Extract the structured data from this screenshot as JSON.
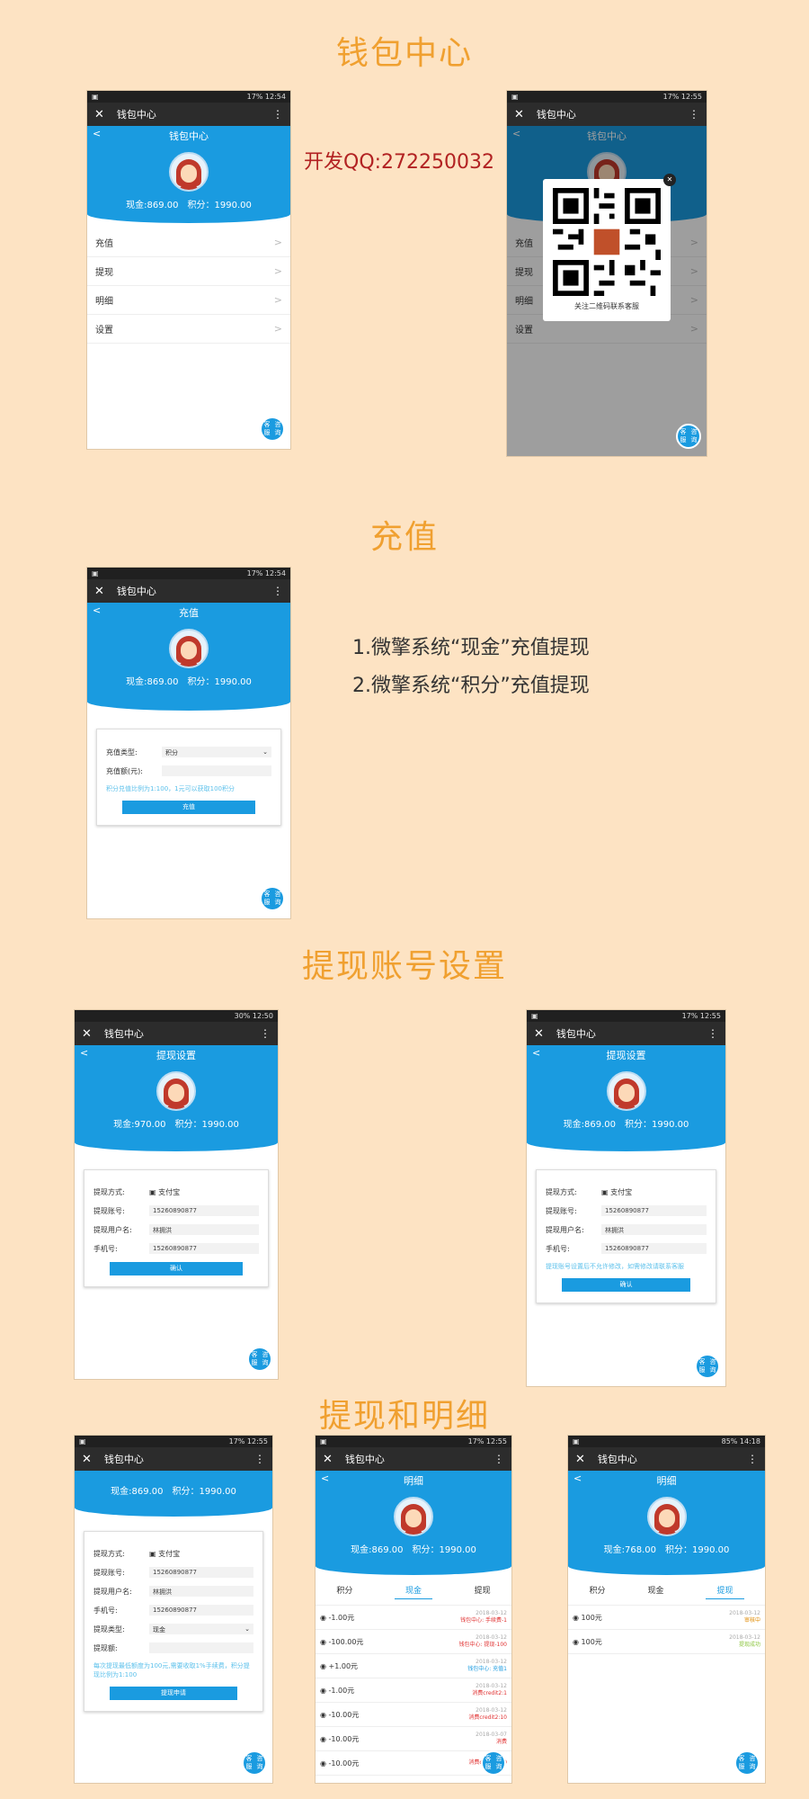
{
  "sections": {
    "wallet": "钱包中心",
    "recharge": "充值",
    "account": "提现账号设置",
    "withdraw_detail": "提现和明细"
  },
  "dev_qq": "开发QQ:272250032",
  "features": [
    "1.微擎系统“现金”充值提现",
    "2.微擎系统“积分”充值提现"
  ],
  "common": {
    "window_title": "钱包中心",
    "close_glyph": "✕",
    "menu_glyph": "⋮",
    "back_glyph": "<",
    "fab_line1": "客服",
    "fab_line2": "咨询",
    "chevron": ">",
    "points": "积分：1990.00",
    "cash_869": "现金:869.00",
    "cash_970": "现金:970.00",
    "cash_768": "现金:768.00"
  },
  "status": {
    "s1254": "17% 12:54",
    "s1255": "17% 12:55",
    "s1250": "30% 12:50",
    "s1418": "85% 14:18"
  },
  "wallet_menu": [
    "充值",
    "提现",
    "明细",
    "设置"
  ],
  "qr_caption": "关注二维码联系客服",
  "recharge_page": {
    "title": "充值",
    "type_label": "充值类型:",
    "type_value": "积分",
    "amount_label": "充值额(元):",
    "hint": "积分兑值比例为1:100，1元可以获取100积分",
    "button": "充值"
  },
  "withdraw_settings": {
    "title": "提现设置",
    "method_label": "提现方式:",
    "method_value": "支付宝",
    "account_label": "提现账号:",
    "account_value": "15260890877",
    "name_label": "提现用户名:",
    "name_value": "林拥洪",
    "phone_label": "手机号:",
    "phone_value": "15260890877",
    "confirm": "确认",
    "locked_hint": "提现账号设置后不允许修改，如需修改请联系客服"
  },
  "withdraw_form": {
    "type_label": "提现类型:",
    "type_value": "现金",
    "amount_label": "提现额:",
    "hint": "每次提现最低额度为100元,需要收取1%手续费，积分提现比例为1:100",
    "button": "提现申请"
  },
  "details": {
    "title": "明细",
    "tabs": [
      "积分",
      "现金",
      "提现"
    ],
    "cash_records": [
      {
        "amount": "-1.00元",
        "date": "2018-03-12",
        "memo": "钱包中心: 手续费-1",
        "color": "red"
      },
      {
        "amount": "-100.00元",
        "date": "2018-03-12",
        "memo": "钱包中心: 提现-100",
        "color": "red"
      },
      {
        "amount": "+1.00元",
        "date": "2018-03-12",
        "memo": "钱包中心: 充值1",
        "color": "blue"
      },
      {
        "amount": "-1.00元",
        "date": "2018-03-12",
        "memo": "消费credit2:1",
        "color": "red"
      },
      {
        "amount": "-10.00元",
        "date": "2018-03-12",
        "memo": "消费credit2:10",
        "color": "red"
      },
      {
        "amount": "-10.00元",
        "date": "2018-03-07",
        "memo": "消费",
        "color": "red"
      },
      {
        "amount": "-10.00元",
        "date": "",
        "memo": "消费credit2:10",
        "color": "red"
      }
    ],
    "withdraw_records": [
      {
        "amount": "100元",
        "date": "2018-03-12",
        "memo": "审核中",
        "color": "orange"
      },
      {
        "amount": "100元",
        "date": "2018-03-12",
        "memo": "提现成功",
        "color": "green"
      }
    ]
  }
}
